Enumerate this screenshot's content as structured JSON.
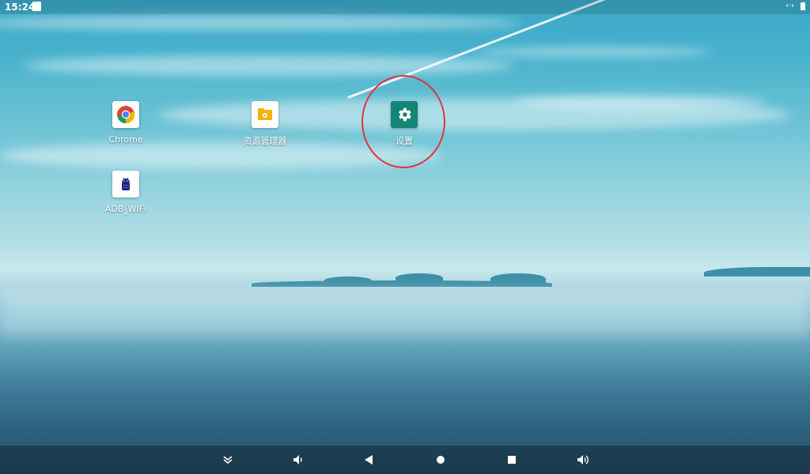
{
  "status_bar": {
    "time": "15:24",
    "icons": [
      "notification-icon",
      "adb-icon",
      "battery-icon"
    ]
  },
  "apps": [
    {
      "label": "Chrome",
      "icon": "chrome-icon"
    },
    {
      "label": "资源管理器",
      "icon": "file-manager-icon"
    },
    {
      "label": "设置",
      "icon": "settings-icon"
    },
    {
      "label": "ADB_WIFI",
      "icon": "android-icon"
    }
  ],
  "navigation_bar": {
    "buttons": [
      "hide-bar-icon",
      "volume-down-icon",
      "back-icon",
      "home-icon",
      "recents-icon",
      "volume-up-icon"
    ]
  },
  "colors": {
    "highlight": "#e0353a",
    "settings_tile": "#128575",
    "file_manager_tile": "#f4b400"
  }
}
